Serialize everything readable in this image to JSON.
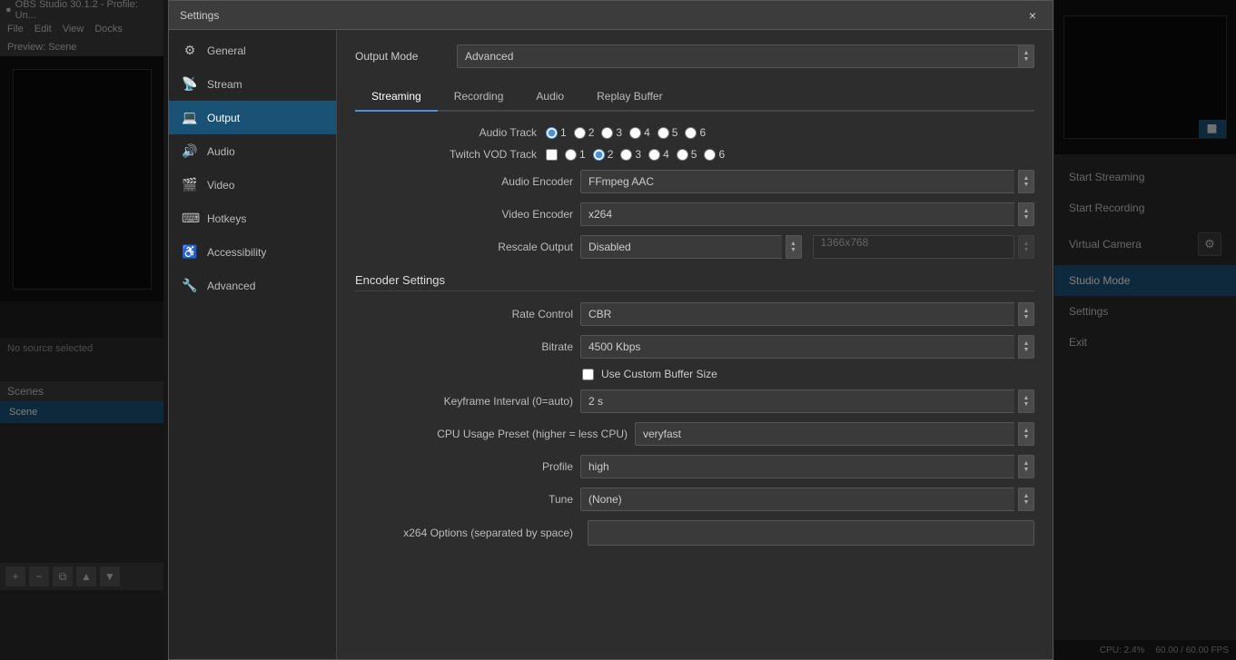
{
  "obs": {
    "titlebar": "OBS Studio 30.1.2 - Profile: Un...",
    "menu": {
      "items": [
        "File",
        "Edit",
        "View",
        "Docks"
      ]
    },
    "preview_title": "Preview: Scene",
    "no_source": "No source selected",
    "scenes": {
      "header": "Scenes",
      "items": [
        {
          "label": "Scene",
          "active": true
        }
      ]
    },
    "right_controls": {
      "start_streaming": "Start Streaming",
      "start_recording": "Start Recording",
      "virtual_camera": "Virtual Camera",
      "studio_mode": "Studio Mode",
      "settings": "Settings",
      "exit": "Exit"
    },
    "status": {
      "cpu": "CPU: 2.4%",
      "fps": "60.00 / 60.00 FPS"
    }
  },
  "settings": {
    "title": "Settings",
    "close_label": "×",
    "output_mode_label": "Output Mode",
    "output_mode_value": "Advanced",
    "nav": [
      {
        "id": "general",
        "label": "General",
        "icon": "⚙"
      },
      {
        "id": "stream",
        "label": "Stream",
        "icon": "📡"
      },
      {
        "id": "output",
        "label": "Output",
        "icon": "💻",
        "active": true
      },
      {
        "id": "audio",
        "label": "Audio",
        "icon": "🔊"
      },
      {
        "id": "video",
        "label": "Video",
        "icon": "🎬"
      },
      {
        "id": "hotkeys",
        "label": "Hotkeys",
        "icon": "⌨"
      },
      {
        "id": "accessibility",
        "label": "Accessibility",
        "icon": "♿"
      },
      {
        "id": "advanced",
        "label": "Advanced",
        "icon": "🔧"
      }
    ],
    "tabs": [
      {
        "id": "streaming",
        "label": "Streaming",
        "active": true
      },
      {
        "id": "recording",
        "label": "Recording"
      },
      {
        "id": "audio",
        "label": "Audio"
      },
      {
        "id": "replay_buffer",
        "label": "Replay Buffer"
      }
    ],
    "audio_track": {
      "label": "Audio Track",
      "tracks": [
        "1",
        "2",
        "3",
        "4",
        "5",
        "6"
      ]
    },
    "twitch_vod": {
      "label": "Twitch VOD Track",
      "tracks": [
        "1",
        "2",
        "3",
        "4",
        "5",
        "6"
      ]
    },
    "audio_encoder": {
      "label": "Audio Encoder",
      "value": "FFmpeg AAC"
    },
    "video_encoder": {
      "label": "Video Encoder",
      "value": "x264"
    },
    "rescale_output": {
      "label": "Rescale Output",
      "value": "Disabled",
      "disabled_value": "1366x768"
    },
    "encoder_settings_title": "Encoder Settings",
    "rate_control": {
      "label": "Rate Control",
      "value": "CBR"
    },
    "bitrate": {
      "label": "Bitrate",
      "value": "4500 Kbps"
    },
    "custom_buffer": {
      "label": "Use Custom Buffer Size",
      "checked": false
    },
    "keyframe_interval": {
      "label": "Keyframe Interval (0=auto)",
      "value": "2 s"
    },
    "cpu_usage_preset": {
      "label": "CPU Usage Preset (higher = less CPU)",
      "value": "veryfast"
    },
    "profile": {
      "label": "Profile",
      "value": "high"
    },
    "tune": {
      "label": "Tune",
      "value": "(None)"
    },
    "x264_options": {
      "label": "x264 Options (separated by space)",
      "value": ""
    }
  }
}
